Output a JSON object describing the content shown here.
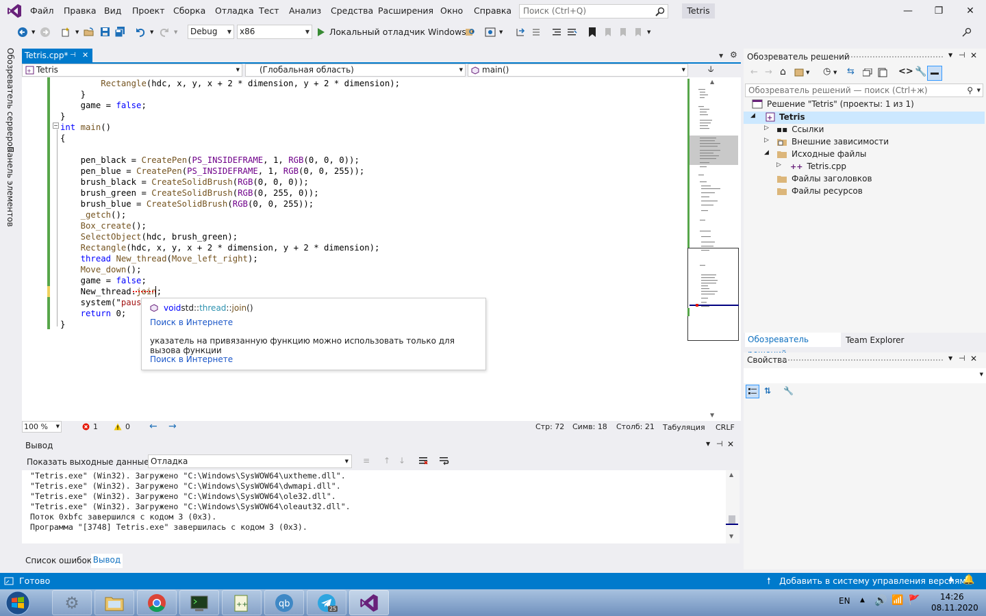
{
  "menubar": {
    "items": [
      "Файл",
      "Правка",
      "Вид",
      "Проект",
      "Сборка",
      "Отладка",
      "Тест",
      "Анализ",
      "Средства",
      "Расширения",
      "Окно",
      "Справка"
    ],
    "search_placeholder": "Поиск (Ctrl+Q)",
    "project_title": "Tetris"
  },
  "toolbar": {
    "config": "Debug",
    "platform": "x86",
    "run_label": "Локальный отладчик Windows"
  },
  "leftbar": {
    "server_explorer": "Обозреватель серверов",
    "toolbox": "Панель элементов"
  },
  "editor": {
    "tab_label": "Tetris.cpp*",
    "nav_project": "Tetris",
    "nav_scope": "(Глобальная область)",
    "nav_member": "main()",
    "lines": [
      [
        {
          "t": "        "
        },
        {
          "t": "Rectangle",
          "c": "fn"
        },
        {
          "t": "(hdc, x, y, x + 2 * dimension, y + 2 * dimension);"
        }
      ],
      [
        {
          "t": "    }"
        }
      ],
      [
        {
          "t": "    game = "
        },
        {
          "t": "false",
          "c": "kw"
        },
        {
          "t": ";"
        }
      ],
      [
        {
          "t": "}"
        }
      ],
      [
        {
          "t": "int",
          "c": "kw"
        },
        {
          "t": " "
        },
        {
          "t": "main",
          "c": "fn"
        },
        {
          "t": "()"
        }
      ],
      [
        {
          "t": "{"
        }
      ],
      [
        {
          "t": ""
        }
      ],
      [
        {
          "t": "    pen_black = "
        },
        {
          "t": "CreatePen",
          "c": "fn"
        },
        {
          "t": "("
        },
        {
          "t": "PS_INSIDEFRAME",
          "c": "mac"
        },
        {
          "t": ", 1, "
        },
        {
          "t": "RGB",
          "c": "mac"
        },
        {
          "t": "(0, 0, 0));"
        }
      ],
      [
        {
          "t": "    pen_blue = "
        },
        {
          "t": "CreatePen",
          "c": "fn"
        },
        {
          "t": "("
        },
        {
          "t": "PS_INSIDEFRAME",
          "c": "mac"
        },
        {
          "t": ", 1, "
        },
        {
          "t": "RGB",
          "c": "mac"
        },
        {
          "t": "(0, 0, 255));"
        }
      ],
      [
        {
          "t": "    brush_black = "
        },
        {
          "t": "CreateSolidBrush",
          "c": "fn"
        },
        {
          "t": "("
        },
        {
          "t": "RGB",
          "c": "mac"
        },
        {
          "t": "(0, 0, 0));"
        }
      ],
      [
        {
          "t": "    brush_green = "
        },
        {
          "t": "CreateSolidBrush",
          "c": "fn"
        },
        {
          "t": "("
        },
        {
          "t": "RGB",
          "c": "mac"
        },
        {
          "t": "(0, 255, 0));"
        }
      ],
      [
        {
          "t": "    brush_blue = "
        },
        {
          "t": "CreateSolidBrush",
          "c": "fn"
        },
        {
          "t": "("
        },
        {
          "t": "RGB",
          "c": "mac"
        },
        {
          "t": "(0, 0, 255));"
        }
      ],
      [
        {
          "t": "    "
        },
        {
          "t": "_getch",
          "c": "fn"
        },
        {
          "t": "();"
        }
      ],
      [
        {
          "t": "    "
        },
        {
          "t": "Box_create",
          "c": "fn"
        },
        {
          "t": "();"
        }
      ],
      [
        {
          "t": "    "
        },
        {
          "t": "SelectObject",
          "c": "fn"
        },
        {
          "t": "(hdc, brush_green);"
        }
      ],
      [
        {
          "t": "    "
        },
        {
          "t": "Rectangle",
          "c": "fn"
        },
        {
          "t": "(hdc, x, y, x + 2 * dimension, y + 2 * dimension);"
        }
      ],
      [
        {
          "t": "    "
        },
        {
          "t": "thread",
          "c": "kw"
        },
        {
          "t": " "
        },
        {
          "t": "New_thread",
          "c": "fn"
        },
        {
          "t": "("
        },
        {
          "t": "Move_left_right",
          "c": "fn"
        },
        {
          "t": ");"
        }
      ],
      [
        {
          "t": "    "
        },
        {
          "t": "Move_down",
          "c": "fn"
        },
        {
          "t": "();"
        }
      ],
      [
        {
          "t": "    game = "
        },
        {
          "t": "false",
          "c": "kw"
        },
        {
          "t": ";"
        }
      ],
      [
        {
          "t": "    New_thread."
        },
        {
          "t": "join",
          "c": "fn"
        },
        {
          "t": ";"
        }
      ],
      [
        {
          "t": "    system(\""
        },
        {
          "t": "pause",
          "c": "str"
        }
      ],
      [
        {
          "t": "    "
        },
        {
          "t": "return",
          "c": "kw"
        },
        {
          "t": " 0;"
        }
      ],
      [
        {
          "t": "}"
        }
      ]
    ],
    "zoom": "100 %",
    "errors": "1",
    "warnings": "0",
    "line": "Стр: 72",
    "char": "Симв: 18",
    "col": "Столб: 21",
    "indent": "Табуляция",
    "eol": "CRLF"
  },
  "tooltip": {
    "signature_prefix": "void ",
    "signature_ns": "std",
    "signature_cls": "thread",
    "signature_fn": "join",
    "signature_suffix": "()",
    "search_link_1": "Поиск в Интернете",
    "message": "указатель на привязанную функцию можно использовать только для вызова функции",
    "search_link_2": "Поиск в Интернете"
  },
  "output": {
    "title": "Вывод",
    "show_label": "Показать выходные данные из:",
    "source": "Отладка",
    "lines": [
      "\"Tetris.exe\" (Win32). Загружено \"C:\\Windows\\SysWOW64\\uxtheme.dll\".",
      "\"Tetris.exe\" (Win32). Загружено \"C:\\Windows\\SysWOW64\\dwmapi.dll\".",
      "\"Tetris.exe\" (Win32). Загружено \"C:\\Windows\\SysWOW64\\ole32.dll\".",
      "\"Tetris.exe\" (Win32). Загружено \"C:\\Windows\\SysWOW64\\oleaut32.dll\".",
      "Поток 0xbfc завершился с кодом 3 (0x3).",
      "Программа \"[3748] Tetris.exe\" завершилась с кодом 3 (0x3)."
    ],
    "tab_errors": "Список ошибок",
    "tab_output": "Вывод"
  },
  "solution": {
    "title": "Обозреватель решений",
    "search_placeholder": "Обозреватель решений — поиск (Ctrl+ж)",
    "root": "Решение \"Tetris\" (проекты: 1 из 1)",
    "project": "Tetris",
    "nodes": [
      "Ссылки",
      "Внешние зависимости",
      "Исходные файлы",
      "Tetris.cpp",
      "Файлы заголовков",
      "Файлы ресурсов"
    ],
    "tab_solution": "Обозреватель решений",
    "tab_team": "Team Explorer"
  },
  "properties": {
    "title": "Свойства"
  },
  "statusbar": {
    "ready": "Готово",
    "vcs": "Добавить в систему управления версиями"
  },
  "taskbar": {
    "lang": "EN",
    "time": "14:26",
    "date": "08.11.2020",
    "telegram_badge": "25"
  }
}
